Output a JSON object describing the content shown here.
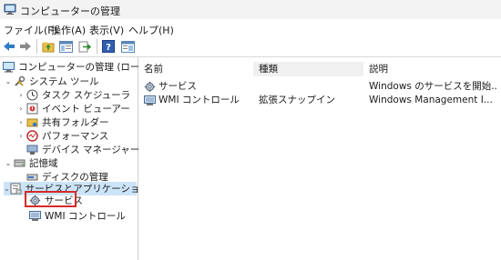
{
  "window": {
    "title": "コンピューターの管理"
  },
  "menu": [
    "ファイル(F)",
    "操作(A)",
    "表示(V)",
    "ヘルプ(H)"
  ],
  "toolbar": {
    "buttons": [
      "back-arrow-icon",
      "forward-arrow-icon",
      "up-folder-icon",
      "show-hide-tree-icon",
      "export-list-icon",
      "help-icon",
      "properties-icon"
    ]
  },
  "tree": {
    "root": "コンピューターの管理 (ローカル)",
    "system_tools": "システム ツール",
    "task_scheduler": "タスク スケジューラ",
    "event_viewer": "イベント ビューアー",
    "shared_folders": "共有フォルダー",
    "performance": "パフォーマンス",
    "device_manager": "デバイス マネージャー",
    "storage": "記憶域",
    "disk_management": "ディスクの管理",
    "services_apps": "サービスとアプリケーション",
    "services": "サービス",
    "wmi_control": "WMI コントロール"
  },
  "table": {
    "columns": [
      "名前",
      "種類",
      "説明"
    ],
    "rows": [
      {
        "name": "サービス",
        "type": "",
        "description": "Windows のサービスを開始..."
      },
      {
        "name": "WMI コントロール",
        "type": "拡張スナップイン",
        "description": "Windows Management I..."
      }
    ]
  },
  "colors": {
    "selection": "#cce4f7",
    "highlight_box": "#d62a2a",
    "header_bg": "#f0f0f0"
  }
}
